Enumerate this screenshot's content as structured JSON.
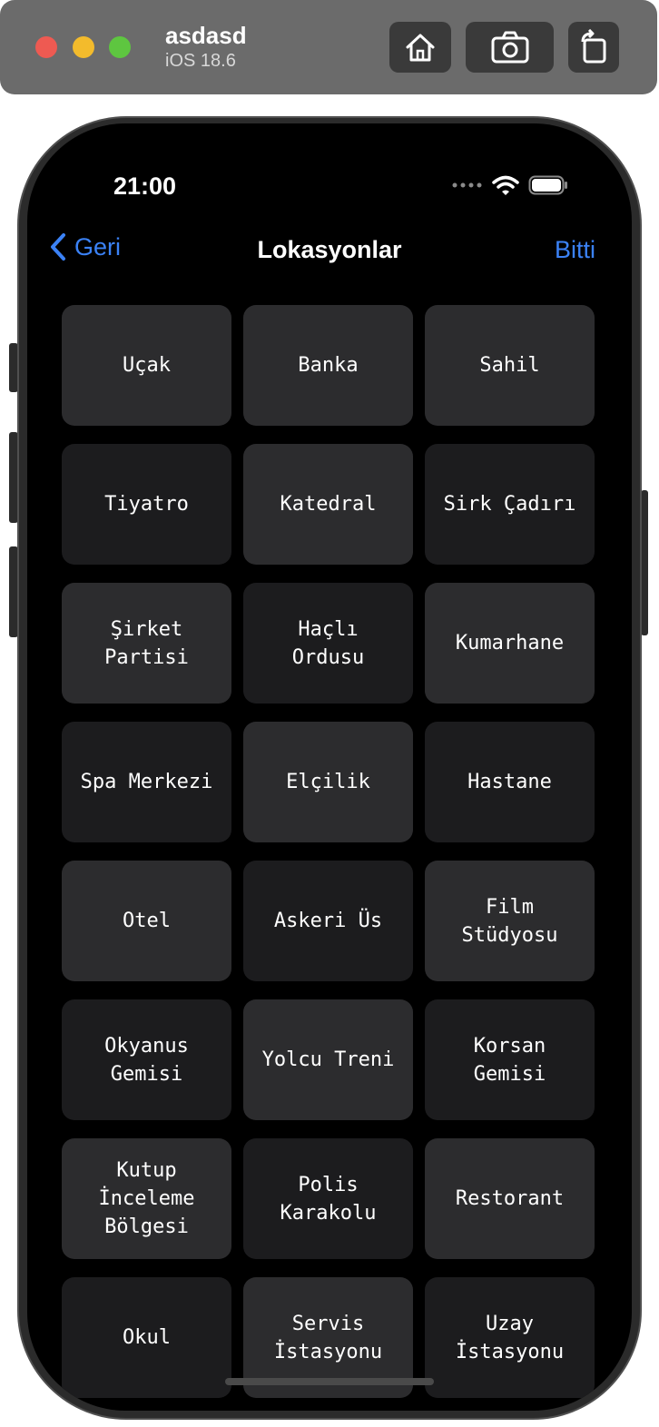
{
  "simulator": {
    "device_name": "asdasd",
    "os_version": "iOS 18.6",
    "buttons": [
      "home-icon",
      "screenshot-icon",
      "rotate-icon"
    ]
  },
  "status_bar": {
    "time": "21:00",
    "icons": [
      "signal-dots-icon",
      "wifi-icon",
      "battery-icon"
    ]
  },
  "nav": {
    "back_label": "Geri",
    "title": "Lokasyonlar",
    "done_label": "Bitti"
  },
  "locations": [
    "Uçak",
    "Banka",
    "Sahil",
    "Tiyatro",
    "Katedral",
    "Sirk Çadırı",
    "Şirket\nPartisi",
    "Haçlı\nOrdusu",
    "Kumarhane",
    "Spa Merkezi",
    "Elçilik",
    "Hastane",
    "Otel",
    "Askeri Üs",
    "Film\nStüdyosu",
    "Okyanus\nGemisi",
    "Yolcu Treni",
    "Korsan\nGemisi",
    "Kutup\nİnceleme\nBölgesi",
    "Polis\nKarakolu",
    "Restorant",
    "Okul",
    "Servis\nİstasyonu",
    "Uzay\nİstasyonu"
  ],
  "colors": {
    "accent": "#3b82f6",
    "tile_light": "#2c2c2e",
    "tile_dark": "#1c1c1e",
    "screen_bg": "#000000"
  }
}
